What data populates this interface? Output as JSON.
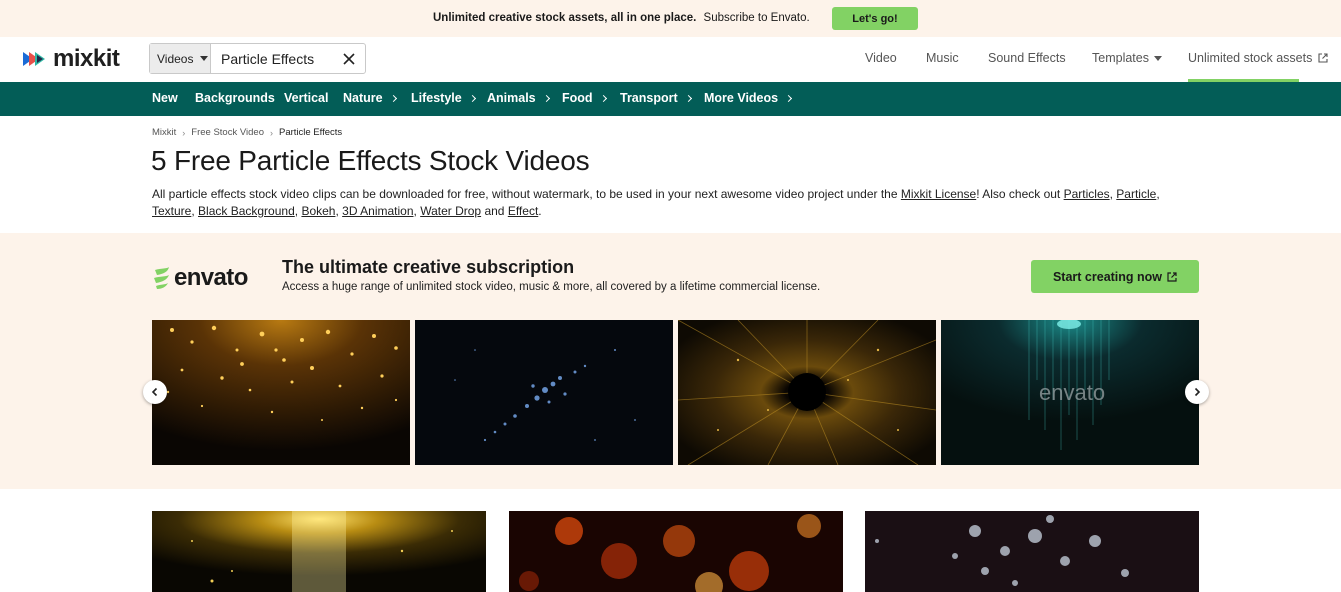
{
  "promo": {
    "bold_text": "Unlimited creative stock assets, all in one place.",
    "text": "Subscribe to Envato.",
    "button_label": "Let's go!"
  },
  "header": {
    "logo_text": "mixkit",
    "search": {
      "type_label": "Videos",
      "value": "Particle Effects"
    },
    "nav": [
      {
        "label": "Video"
      },
      {
        "label": "Music"
      },
      {
        "label": "Sound Effects"
      },
      {
        "label": "Templates"
      },
      {
        "label": "Unlimited stock assets"
      }
    ]
  },
  "categories": [
    "New",
    "Backgrounds",
    "Vertical",
    "Nature",
    "Lifestyle",
    "Animals",
    "Food",
    "Transport",
    "More Videos"
  ],
  "breadcrumb": [
    "Mixkit",
    "Free Stock Video",
    "Particle Effects"
  ],
  "page": {
    "title": "5 Free Particle Effects Stock Videos",
    "desc_prefix": "All particle effects stock video clips can be downloaded for free, without watermark, to be used in your next awesome video project under the",
    "license_link": "Mixkit License",
    "desc_mid": "! Also check out",
    "related": [
      "Particles",
      "Particle",
      "Texture",
      "Black Background",
      "Bokeh",
      "3D Animation",
      "Water Drop",
      "Effect"
    ],
    "and_word": "and"
  },
  "banner": {
    "logo_text": "envato",
    "title": "The ultimate creative subscription",
    "subtitle": "Access a huge range of unlimited stock video, music & more, all covered by a lifetime commercial license.",
    "cta_label": "Start creating now",
    "watermark_text": "envato"
  },
  "colors": {
    "accent_green": "#82d264",
    "nav_teal": "#035d57",
    "banner_bg": "#fdf3ea"
  }
}
